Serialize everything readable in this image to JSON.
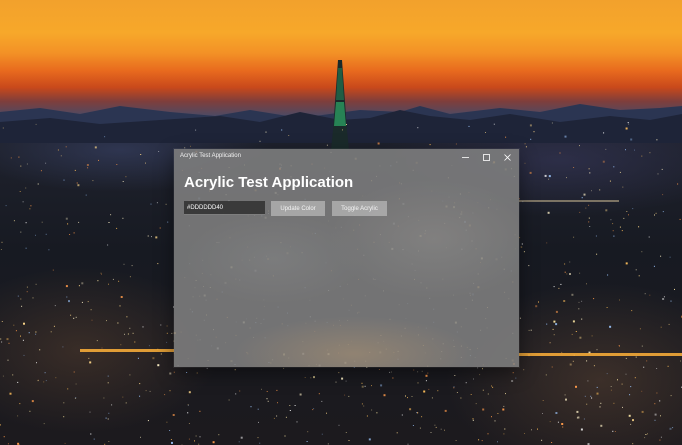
{
  "window": {
    "title": "Acrylic Test Application",
    "controls": {
      "minimize_icon": "minimize-icon",
      "maximize_icon": "maximize-icon",
      "close_icon": "close-icon"
    }
  },
  "main": {
    "heading": "Acrylic Test Application",
    "color_input": {
      "value": "#DDDDDD40",
      "placeholder": ""
    },
    "update_button_label": "Update Color",
    "toggle_button_label": "Toggle Acrylic"
  },
  "colors": {
    "acrylic_tint": "#DDDDDD40",
    "window_background": "#808080",
    "button_background": "#AFAFAF",
    "heading_text": "#FFFFFF"
  }
}
